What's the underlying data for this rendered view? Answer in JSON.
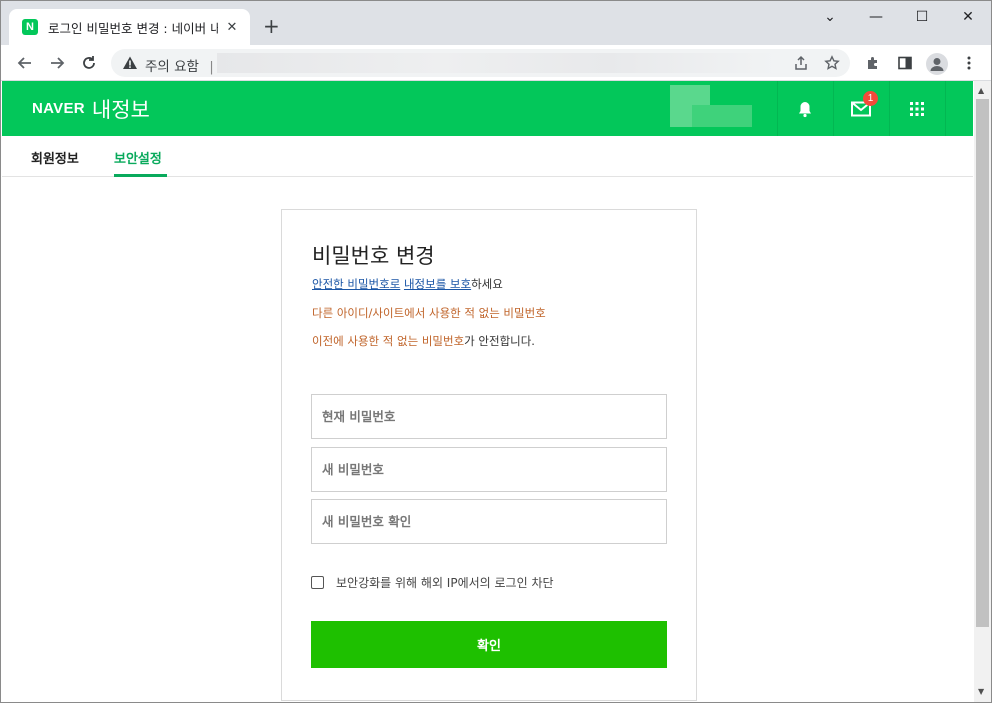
{
  "browser": {
    "tab_title": "로그인 비밀번호 변경 : 네이버 내정보",
    "tab_close": "✕",
    "new_tab": "+",
    "controls": {
      "dropdown": "⌄",
      "minimize": "—",
      "maximize": "☐",
      "close": "✕"
    },
    "security_warning": "주의 요함",
    "url_separator": "|"
  },
  "header": {
    "brand": "NAVER",
    "title": "내정보",
    "mail_badge": "1"
  },
  "subnav": {
    "items": [
      {
        "label": "회원정보"
      },
      {
        "label": "보안설정"
      }
    ]
  },
  "form": {
    "title": "비밀번호 변경",
    "desc_link_1": "안전한 비밀번호로",
    "desc_link_2": "내정보를 보호",
    "desc_suffix": "하세요",
    "warning_1": "다른 아이디/사이트에서 사용한 적 없는 비밀번호",
    "warning_2": "이전에 사용한 적 없는 비밀번호",
    "warning_2_suffix": "가 안전합니다.",
    "current_password_placeholder": "현재 비밀번호",
    "new_password_placeholder": "새 비밀번호",
    "confirm_password_placeholder": "새 비밀번호 확인",
    "block_foreign_ip_label": "보안강화를 위해 해외 IP에서의 로그인 차단",
    "submit_label": "확인"
  },
  "colors": {
    "brand_green": "#03c75a",
    "button_green": "#1ec000",
    "active_tab": "#09aa5c",
    "warning_orange": "#c0642a",
    "link_blue": "#1a55a5",
    "badge_red": "#f54a3a"
  }
}
